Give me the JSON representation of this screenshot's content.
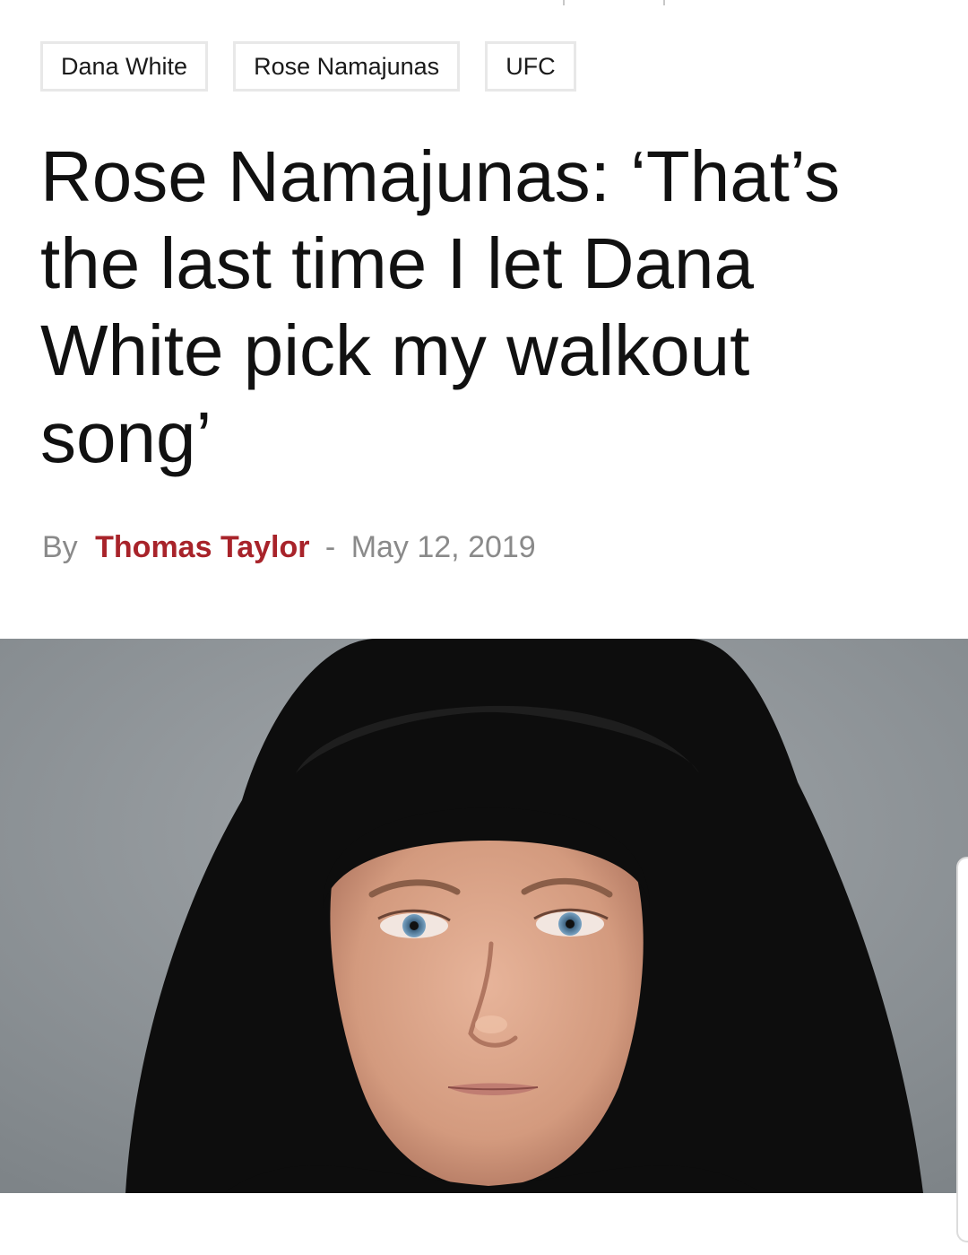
{
  "tags": [
    {
      "label": "Dana White"
    },
    {
      "label": "Rose Namajunas"
    },
    {
      "label": "UFC"
    }
  ],
  "article": {
    "headline": "Rose Namajunas: ‘That’s the last time I let Dana White pick my walkout song’",
    "byline_prefix": "By",
    "author": "Thomas Taylor",
    "separator": "-",
    "date": "May 12, 2019"
  },
  "colors": {
    "author": "#a8232a",
    "meta": "#8a8a8a",
    "tag_border": "#e8e8e8"
  },
  "icons": {
    "photo": "portrait-photo"
  }
}
